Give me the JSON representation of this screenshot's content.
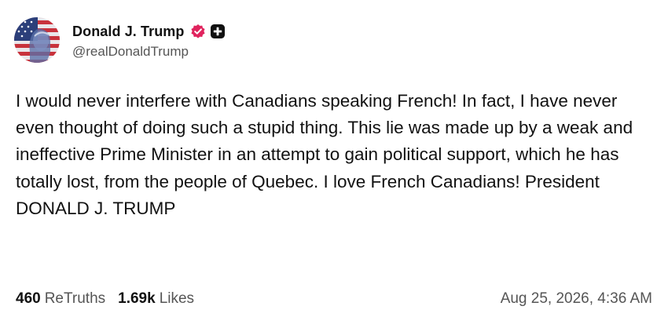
{
  "post": {
    "author": {
      "display_name": "Donald J. Trump",
      "handle": "@realDonaldTrump",
      "avatar_icon": "avatar-flag-portrait",
      "verified_icon": "verified-badge-icon",
      "affiliation_icon": "plus-badge-icon"
    },
    "text": "I would never interfere with Canadians speaking French! In fact, I have never even thought of doing such a stupid thing. This lie was made up by a weak and ineffective Prime Minister in an attempt to gain political support, which he has totally lost, from the people of Quebec. I love French Canadians! President DONALD J. TRUMP",
    "stats": {
      "retruths_count": "460",
      "retruths_label": "ReTruths",
      "likes_count": "1.69k",
      "likes_label": "Likes"
    },
    "timestamp": "Aug 25, 2026, 4:36 AM"
  },
  "colors": {
    "text_primary": "#111111",
    "text_secondary": "#555555",
    "verified_badge": "#e0245e",
    "affiliation_badge": "#111111"
  }
}
